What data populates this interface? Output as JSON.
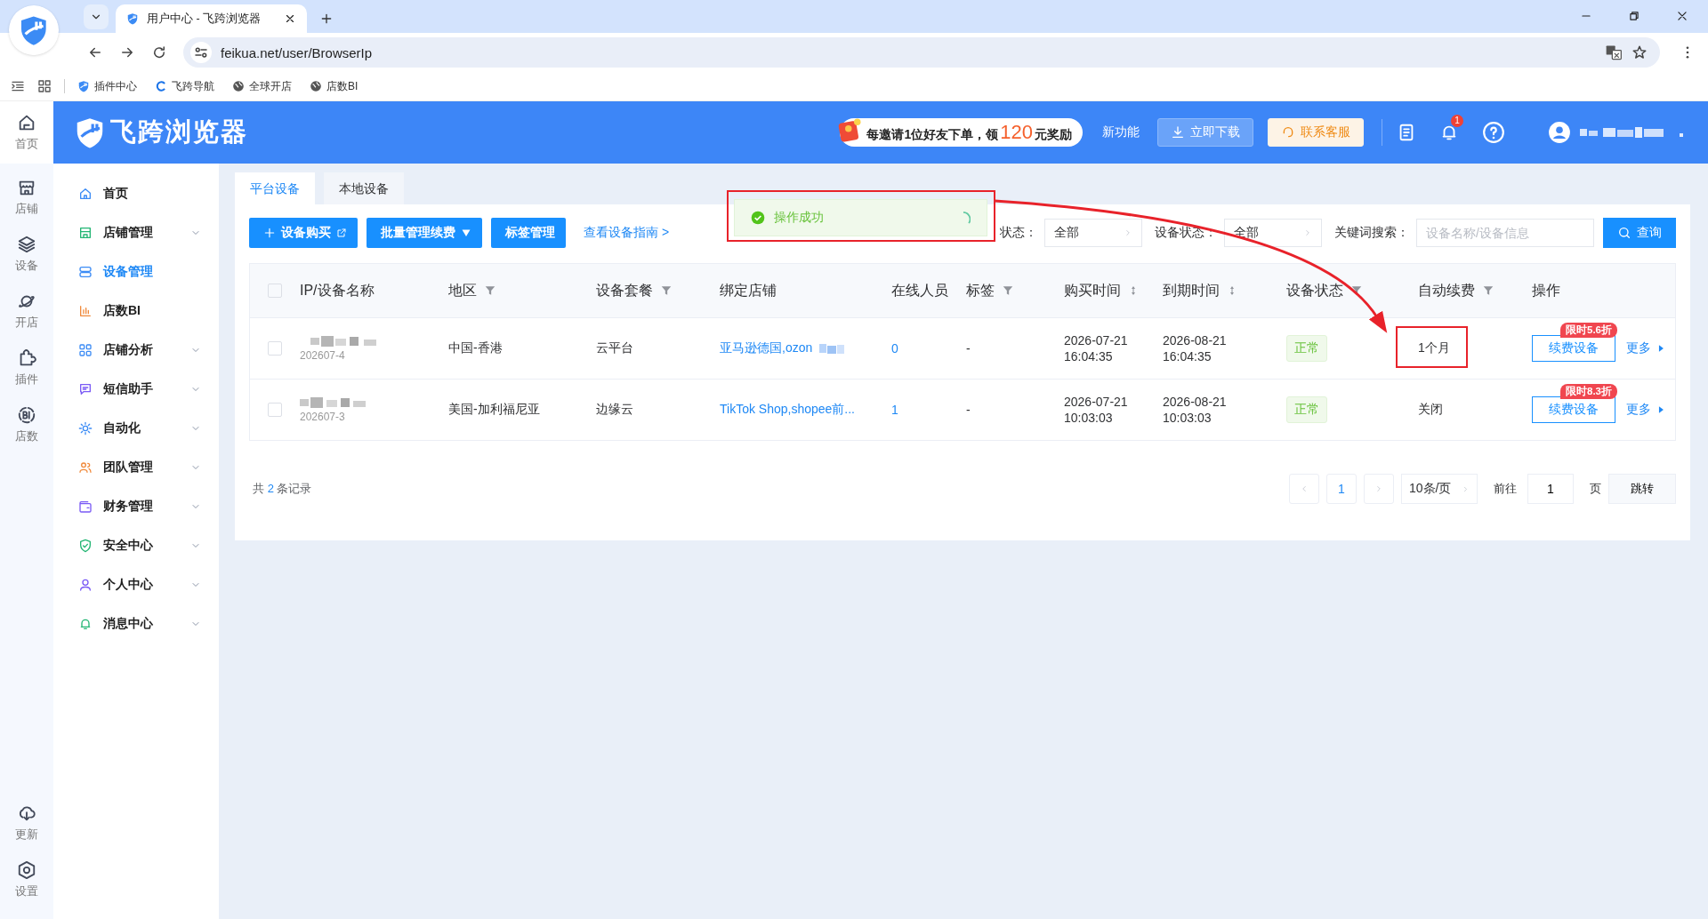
{
  "browser": {
    "tab_title": "用户中心 - 飞跨浏览器",
    "url": "feikua.net/user/BrowserIp",
    "bookmarks": [
      "插件中心",
      "飞跨导航",
      "全球开店",
      "店数BI"
    ]
  },
  "header": {
    "logo_text": "飞跨浏览器",
    "promo": {
      "before": "每邀请1位好友下单，领",
      "amount": "120",
      "after": "元奖励"
    },
    "new_features": "新功能",
    "download": "立即下载",
    "support": "联系客服",
    "notification_count": "1"
  },
  "rail": {
    "top": [
      {
        "label": "首页"
      },
      {
        "label": "店铺"
      },
      {
        "label": "设备"
      },
      {
        "label": "开店"
      },
      {
        "label": "插件"
      },
      {
        "label": "店数"
      }
    ],
    "bottom": [
      {
        "label": "更新"
      },
      {
        "label": "设置"
      }
    ]
  },
  "sidebar": {
    "items": [
      {
        "label": "首页",
        "selected": false,
        "expandable": false
      },
      {
        "label": "店铺管理",
        "selected": false,
        "expandable": true
      },
      {
        "label": "设备管理",
        "selected": true,
        "expandable": false
      },
      {
        "label": "店数BI",
        "selected": false,
        "expandable": false
      },
      {
        "label": "店铺分析",
        "selected": false,
        "expandable": true
      },
      {
        "label": "短信助手",
        "selected": false,
        "expandable": true
      },
      {
        "label": "自动化",
        "selected": false,
        "expandable": true
      },
      {
        "label": "团队管理",
        "selected": false,
        "expandable": true
      },
      {
        "label": "财务管理",
        "selected": false,
        "expandable": true
      },
      {
        "label": "安全中心",
        "selected": false,
        "expandable": true
      },
      {
        "label": "个人中心",
        "selected": false,
        "expandable": true
      },
      {
        "label": "消息中心",
        "selected": false,
        "expandable": true
      }
    ]
  },
  "tabs": [
    {
      "label": "平台设备",
      "selected": true
    },
    {
      "label": "本地设备",
      "selected": false
    }
  ],
  "toolbar": {
    "buttons": [
      {
        "label": "设备购买",
        "kind": "purchase"
      },
      {
        "label": "批量管理续费",
        "kind": "dropdown"
      },
      {
        "label": "标签管理",
        "kind": "plain"
      }
    ],
    "guide_link": "查看设备指南 >"
  },
  "filters": [
    {
      "label": "状态：",
      "value": "全部"
    },
    {
      "label": "设备状态：",
      "value": "全部"
    }
  ],
  "search": {
    "label": "关键词搜索：",
    "placeholder": "设备名称/设备信息",
    "button": "查询"
  },
  "toast": {
    "message": "操作成功"
  },
  "table": {
    "header_checked": false,
    "columns": [
      {
        "label": "IP/设备名称",
        "kind": "plain"
      },
      {
        "label": "地区",
        "kind": "filter"
      },
      {
        "label": "设备套餐",
        "kind": "filter"
      },
      {
        "label": "绑定店铺",
        "kind": "plain"
      },
      {
        "label": "在线人员",
        "kind": "plain"
      },
      {
        "label": "标签",
        "kind": "filter"
      },
      {
        "label": "购买时间",
        "kind": "sort"
      },
      {
        "label": "到期时间",
        "kind": "sort"
      },
      {
        "label": "设备状态",
        "kind": "filter"
      },
      {
        "label": "自动续费",
        "kind": "filter"
      },
      {
        "label": "操作",
        "kind": "plain"
      }
    ],
    "rows": [
      {
        "checked": false,
        "device_id": "202607-4",
        "region": "中国-香港",
        "plan": "云平台",
        "stores": "亚马逊德国,ozon",
        "online": "0",
        "tags": "-",
        "purchased": "2026-07-21 16:04:35",
        "expires": "2026-08-21 16:04:35",
        "status": "正常",
        "auto_renew": "1个月",
        "discount": "限时5.6折",
        "renew": "续费设备",
        "more": "更多"
      },
      {
        "checked": false,
        "device_id": "202607-3",
        "region": "美国-加利福尼亚",
        "plan": "边缘云",
        "stores": "TikTok Shop,shopee前...",
        "online": "1",
        "tags": "-",
        "purchased": "2026-07-21 10:03:03",
        "expires": "2026-08-21 10:03:03",
        "status": "正常",
        "auto_renew": "关闭",
        "discount": "限时8.3折",
        "renew": "续费设备",
        "more": "更多"
      }
    ]
  },
  "pagination": {
    "total_before": "共",
    "total_count": "2",
    "total_after": "条记录",
    "pages": [
      {
        "label": "1",
        "selected": true
      }
    ],
    "page_size": "10条/页",
    "goto_label": "前往",
    "goto_value": "1",
    "page_unit": "页",
    "jump": "跳转"
  }
}
